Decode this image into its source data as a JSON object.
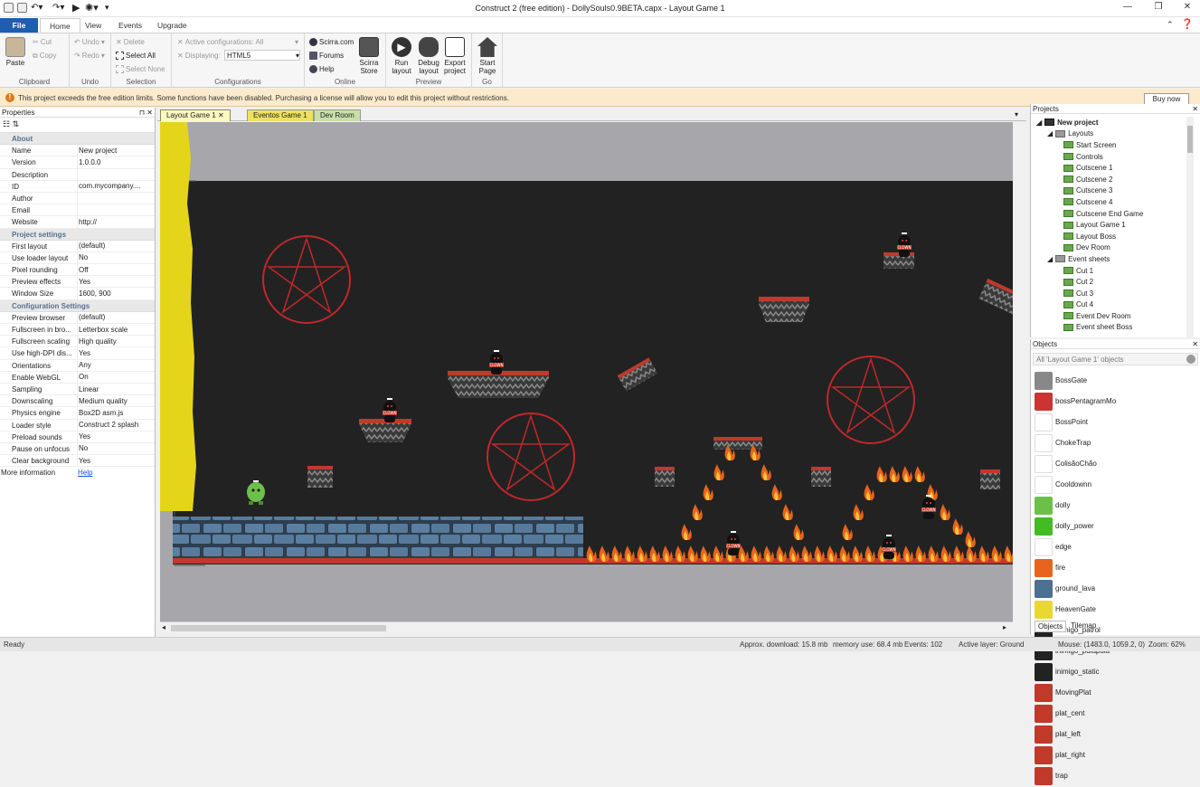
{
  "window": {
    "title": "Construct 2  (free edition) - DollySouls0.9BETA.capx - Layout Game 1"
  },
  "ribbon_tabs": [
    "File",
    "Home",
    "View",
    "Events",
    "Upgrade"
  ],
  "ribbon": {
    "clipboard": {
      "paste": "Paste",
      "cut": "Cut",
      "copy": "Copy",
      "label": "Clipboard"
    },
    "undo": {
      "undo": "Undo",
      "redo": "Redo",
      "label": "Undo"
    },
    "selection": {
      "delete": "Delete",
      "select_all": "Select All",
      "select_none": "Select None",
      "label": "Selection"
    },
    "configurations": {
      "active": "Active configurations: All",
      "displaying_label": "Displaying:",
      "displaying_value": "HTML5",
      "label": "Configurations"
    },
    "online": {
      "scirra": "Scirra.com",
      "forums": "Forums",
      "help": "Help",
      "store": "Scirra Store",
      "label": "Online"
    },
    "preview": {
      "run": "Run layout",
      "debug": "Debug layout",
      "export": "Export project",
      "label": "Preview"
    },
    "go": {
      "start": "Start Page",
      "label": "Go"
    }
  },
  "infobar": {
    "text": "This project exceeds the free edition limits.  Some functions have been disabled.  Purchasing a license will allow you to edit this project without restrictions.",
    "buy": "Buy now"
  },
  "properties": {
    "title": "Properties",
    "sections": [
      {
        "name": "About",
        "rows": [
          [
            "Name",
            "New project"
          ],
          [
            "Version",
            "1.0.0.0"
          ],
          [
            "Description",
            ""
          ],
          [
            "ID",
            "com.mycompany...."
          ],
          [
            "Author",
            ""
          ],
          [
            "Email",
            ""
          ],
          [
            "Website",
            "http://"
          ]
        ]
      },
      {
        "name": "Project settings",
        "rows": [
          [
            "First layout",
            "(default)"
          ],
          [
            "Use loader layout",
            "No"
          ],
          [
            "Pixel rounding",
            "Off"
          ],
          [
            "Preview effects",
            "Yes"
          ],
          [
            "Window Size",
            "1600, 900"
          ]
        ]
      },
      {
        "name": "Configuration Settings",
        "rows": [
          [
            "Preview browser",
            "(default)"
          ],
          [
            "Fullscreen in bro...",
            "Letterbox scale"
          ],
          [
            "Fullscreen scaling",
            "High quality"
          ],
          [
            "Use high-DPI dis...",
            "Yes"
          ],
          [
            "Orientations",
            "Any"
          ],
          [
            "Enable WebGL",
            "On"
          ],
          [
            "Sampling",
            "Linear"
          ],
          [
            "Downscaling",
            "Medium quality"
          ],
          [
            "Physics engine",
            "Box2D asm.js"
          ],
          [
            "Loader style",
            "Construct 2 splash"
          ],
          [
            "Preload sounds",
            "Yes"
          ],
          [
            "Pause on unfocus",
            "No"
          ],
          [
            "Clear background",
            "Yes"
          ]
        ]
      }
    ],
    "more_info": "More information",
    "help_link": "Help"
  },
  "doc_tabs": [
    "Layout Game 1",
    "Eventos Game 1",
    "Dev Room"
  ],
  "projects": {
    "title": "Projects",
    "root": "New project",
    "layouts_folder": "Layouts",
    "layouts": [
      "Start Screen",
      "Controls",
      "Cutscene 1",
      "Cutscene 2",
      "Cutscene 3",
      "Cutscene 4",
      "Cutscene End Game",
      "Layout Game 1",
      "Layout Boss",
      "Dev Room"
    ],
    "events_folder": "Event sheets",
    "events": [
      "Cut 1",
      "Cut 2",
      "Cut 3",
      "Cut 4",
      "Event Dev Room",
      "Event sheet Boss"
    ]
  },
  "objects": {
    "title": "Objects",
    "filter": "All 'Layout Game 1' objects",
    "items": [
      {
        "name": "BossGate",
        "icon": "boss-gate-icon",
        "color": "#888888"
      },
      {
        "name": "bossPentagramMo",
        "icon": "pentagram-icon",
        "color": "#cc3333"
      },
      {
        "name": "BossPoint",
        "icon": "boss-point-icon",
        "color": "#ffffff"
      },
      {
        "name": "ChokeTrap",
        "icon": "choke-trap-icon",
        "color": "#ffffff"
      },
      {
        "name": "ColisãoChão",
        "icon": "collision-floor-icon",
        "color": "#ffffff"
      },
      {
        "name": "Cooldownn",
        "icon": "text-object-icon",
        "color": "#ffffff"
      },
      {
        "name": "dolly",
        "icon": "dolly-icon",
        "color": "#6cc04a"
      },
      {
        "name": "dolly_power",
        "icon": "dolly-power-icon",
        "color": "#44bb22"
      },
      {
        "name": "edge",
        "icon": "edge-icon",
        "color": "#ffffff"
      },
      {
        "name": "fire",
        "icon": "fire-icon",
        "color": "#e8641c"
      },
      {
        "name": "ground_lava",
        "icon": "ground-lava-icon",
        "color": "#4b7090"
      },
      {
        "name": "HeavenGate",
        "icon": "heaven-gate-icon",
        "color": "#e8d830"
      },
      {
        "name": "inimigo_patrol",
        "icon": "enemy-patrol-icon",
        "color": "#222222"
      },
      {
        "name": "inimigo_pulapula",
        "icon": "enemy-jumper-icon",
        "color": "#222222"
      },
      {
        "name": "inimigo_static",
        "icon": "enemy-static-icon",
        "color": "#222222"
      },
      {
        "name": "MovingPlat",
        "icon": "moving-platform-icon",
        "color": "#c0392b"
      },
      {
        "name": "plat_cent",
        "icon": "platform-center-icon",
        "color": "#c0392b"
      },
      {
        "name": "plat_left",
        "icon": "platform-left-icon",
        "color": "#c0392b"
      },
      {
        "name": "plat_right",
        "icon": "platform-right-icon",
        "color": "#c0392b"
      },
      {
        "name": "trap",
        "icon": "trap-icon",
        "color": "#c0392b"
      }
    ],
    "tabs": [
      "Objects",
      "Tilemap"
    ]
  },
  "status": {
    "ready": "Ready",
    "download": "Approx. download: 15.8 mb",
    "memory": "memory use: 68.4 mb",
    "events": "Events: 102",
    "layer": "Active layer: Ground",
    "mouse": "Mouse: (1483.0, 1059.2, 0)",
    "zoom": "Zoom: 62%"
  },
  "colors": {
    "accent": "#1e5eb0",
    "scene_bg": "#222222",
    "lava": "#c0392b",
    "stone": "#4b7090",
    "yellow_wall": "#e5d51a"
  }
}
